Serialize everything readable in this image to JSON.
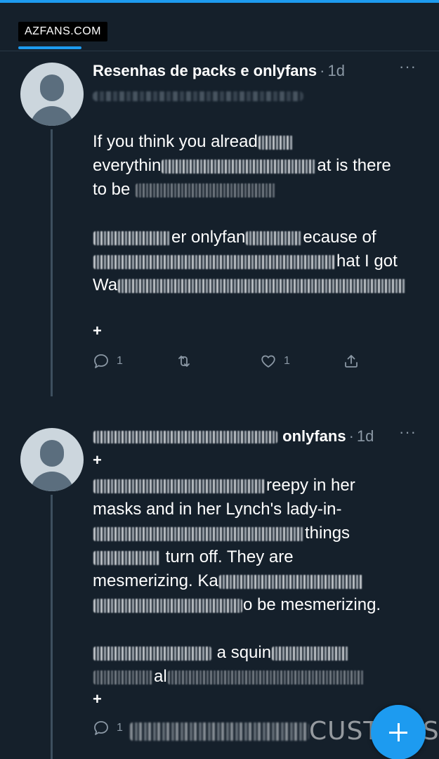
{
  "brand": {
    "label": "AZFANS.COM"
  },
  "tweets": [
    {
      "display_name": "Resenhas de packs e onlyfans",
      "separator": "·",
      "time": "1d",
      "more": "···",
      "lines": [
        {
          "a": "If you think you alread",
          "b": ""
        },
        {
          "a": "everythin",
          "b": "at is there"
        },
        {
          "a": "to be",
          "b": ""
        },
        {
          "a": "",
          "b": ""
        },
        {
          "a": "",
          "b": "er onlyfan",
          "c": "ecause of"
        },
        {
          "a": "",
          "b": "hat I got"
        },
        {
          "a": "Wa",
          "b": ""
        }
      ],
      "plus": "+",
      "reply_count": "1",
      "retweet_count": "",
      "like_count": "1"
    },
    {
      "display_name": "onlyfans",
      "separator": "·",
      "time": "1d",
      "more": "···",
      "plus_top": "+",
      "lines": [
        {
          "a": "",
          "b": "reepy in her"
        },
        {
          "a": "masks and in her Lynch's lady-in-",
          "b": ""
        },
        {
          "a": "",
          "b": "things"
        },
        {
          "a": "",
          "b": "turn off. They are"
        },
        {
          "a": "mesmerizing. Ka",
          "b": ""
        },
        {
          "a": "",
          "b": "o be mesmerizing."
        },
        {
          "a": "",
          "b": ""
        },
        {
          "a": "",
          "b": "a squin"
        },
        {
          "a": "",
          "b": "al"
        }
      ],
      "plus": "+",
      "reply_count": "1"
    }
  ],
  "watermark": "CUSTOMS",
  "colors": {
    "background": "#15202b",
    "accent": "#1d9bf0",
    "muted": "#8b98a5"
  }
}
